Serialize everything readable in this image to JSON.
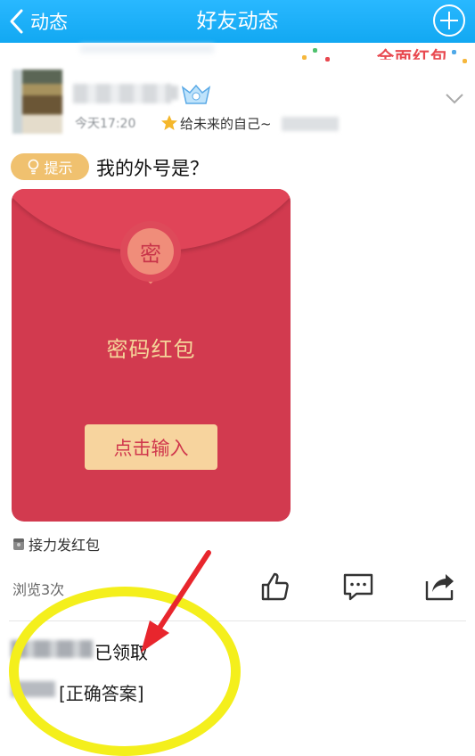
{
  "nav": {
    "back_label": "动态",
    "title": "好友动态"
  },
  "banner": {
    "text": "全面红包"
  },
  "post": {
    "time": "今天17:20",
    "source": "给未来的自己~",
    "hint_label": "提示",
    "question": "我的外号是？"
  },
  "red_packet": {
    "seal_char": "密",
    "title": "密码红包",
    "enter_label": "点击输入"
  },
  "relay_label": "接力发红包",
  "views_label": "浏览3次",
  "claim": {
    "claimed_text": "已领取",
    "answer_text": "[正确答案]"
  },
  "colors": {
    "nav_bg": "#12a8f2",
    "packet_red": "#d23a4f",
    "packet_gold": "#f5d59a",
    "hint_orange": "#f0c16f",
    "annotation_yellow": "#f4ef1c",
    "annotation_red": "#e8262d"
  }
}
